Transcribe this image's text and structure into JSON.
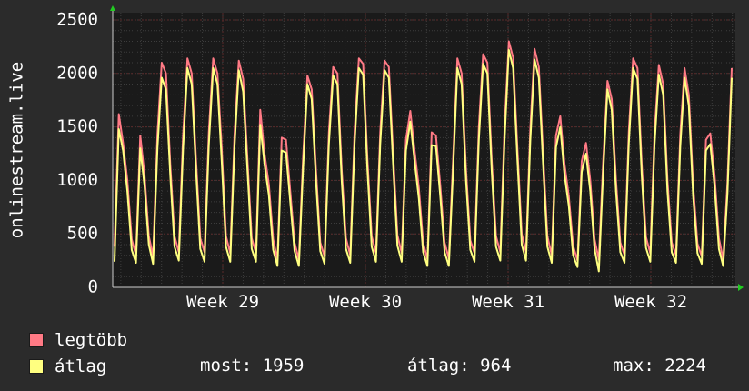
{
  "chart_data": {
    "type": "line",
    "ylabel": "onlinestream.live",
    "ylim": [
      0,
      2500
    ],
    "yticks": [
      0,
      500,
      1000,
      1500,
      2000,
      2500
    ],
    "xtick_labels": [
      "Week 29",
      "Week 30",
      "Week 31",
      "Week 32"
    ],
    "grid": true,
    "series": [
      {
        "name": "legtöbb",
        "color": "#ff7a85",
        "values": [
          380,
          1620,
          1350,
          1000,
          450,
          300,
          1420,
          1050,
          480,
          290,
          1430,
          2100,
          2000,
          1150,
          480,
          330,
          1420,
          2140,
          2000,
          1200,
          460,
          330,
          1450,
          2140,
          2000,
          1300,
          480,
          320,
          1430,
          2120,
          1950,
          1200,
          460,
          320,
          1660,
          1250,
          960,
          450,
          260,
          1400,
          1380,
          900,
          420,
          260,
          1230,
          1980,
          1850,
          1100,
          420,
          290,
          1450,
          2060,
          2000,
          1100,
          460,
          300,
          1460,
          2140,
          2090,
          1200,
          480,
          320,
          1450,
          2120,
          2060,
          1250,
          490,
          320,
          1380,
          1650,
          1280,
          930,
          420,
          260,
          1450,
          1420,
          950,
          420,
          270,
          1200,
          2140,
          2000,
          1100,
          440,
          320,
          1500,
          2180,
          2100,
          1200,
          480,
          330,
          1500,
          2300,
          2150,
          1300,
          500,
          330,
          1480,
          2230,
          2060,
          1250,
          480,
          300,
          1420,
          1600,
          1150,
          850,
          390,
          250,
          1180,
          1350,
          1000,
          450,
          260,
          1160,
          1930,
          1760,
          1000,
          420,
          300,
          1460,
          2140,
          2050,
          1150,
          470,
          320,
          1450,
          2080,
          1900,
          1000,
          420,
          300,
          1430,
          2050,
          1800,
          950,
          410,
          290,
          1380,
          1440,
          1050,
          460,
          260,
          980,
          2050
        ]
      },
      {
        "name": "átlag",
        "color": "#ffff80",
        "values": [
          240,
          1480,
          1280,
          900,
          350,
          230,
          1300,
          950,
          400,
          220,
          1300,
          1960,
          1850,
          1050,
          380,
          250,
          1300,
          2050,
          1900,
          1100,
          360,
          240,
          1330,
          2050,
          1900,
          1180,
          380,
          240,
          1320,
          2030,
          1830,
          1100,
          360,
          240,
          1520,
          1150,
          860,
          350,
          200,
          1280,
          1260,
          800,
          340,
          200,
          1130,
          1900,
          1760,
          1000,
          340,
          220,
          1340,
          1980,
          1900,
          1000,
          360,
          230,
          1350,
          2050,
          1990,
          1100,
          380,
          240,
          1340,
          2030,
          1960,
          1150,
          390,
          240,
          1280,
          1550,
          1180,
          830,
          330,
          200,
          1330,
          1320,
          850,
          330,
          200,
          1100,
          2050,
          1900,
          1000,
          350,
          240,
          1380,
          2090,
          2000,
          1100,
          380,
          250,
          1380,
          2220,
          2050,
          1200,
          400,
          250,
          1370,
          2130,
          1960,
          1150,
          380,
          230,
          1310,
          1500,
          1050,
          760,
          300,
          190,
          1080,
          1250,
          900,
          360,
          150,
          1060,
          1850,
          1660,
          900,
          330,
          230,
          1350,
          2050,
          1950,
          1050,
          370,
          240,
          1340,
          1990,
          1800,
          900,
          330,
          230,
          1320,
          1960,
          1700,
          850,
          320,
          220,
          1280,
          1340,
          950,
          360,
          200,
          880,
          1959
        ]
      }
    ]
  },
  "legend": [
    {
      "label": "legtöbb",
      "color": "#ff7a85"
    },
    {
      "label": "átlag",
      "color": "#ffff80"
    }
  ],
  "stats": {
    "most": "most: 1959",
    "atlag": "átlag: 964",
    "max": "max: 2224"
  }
}
